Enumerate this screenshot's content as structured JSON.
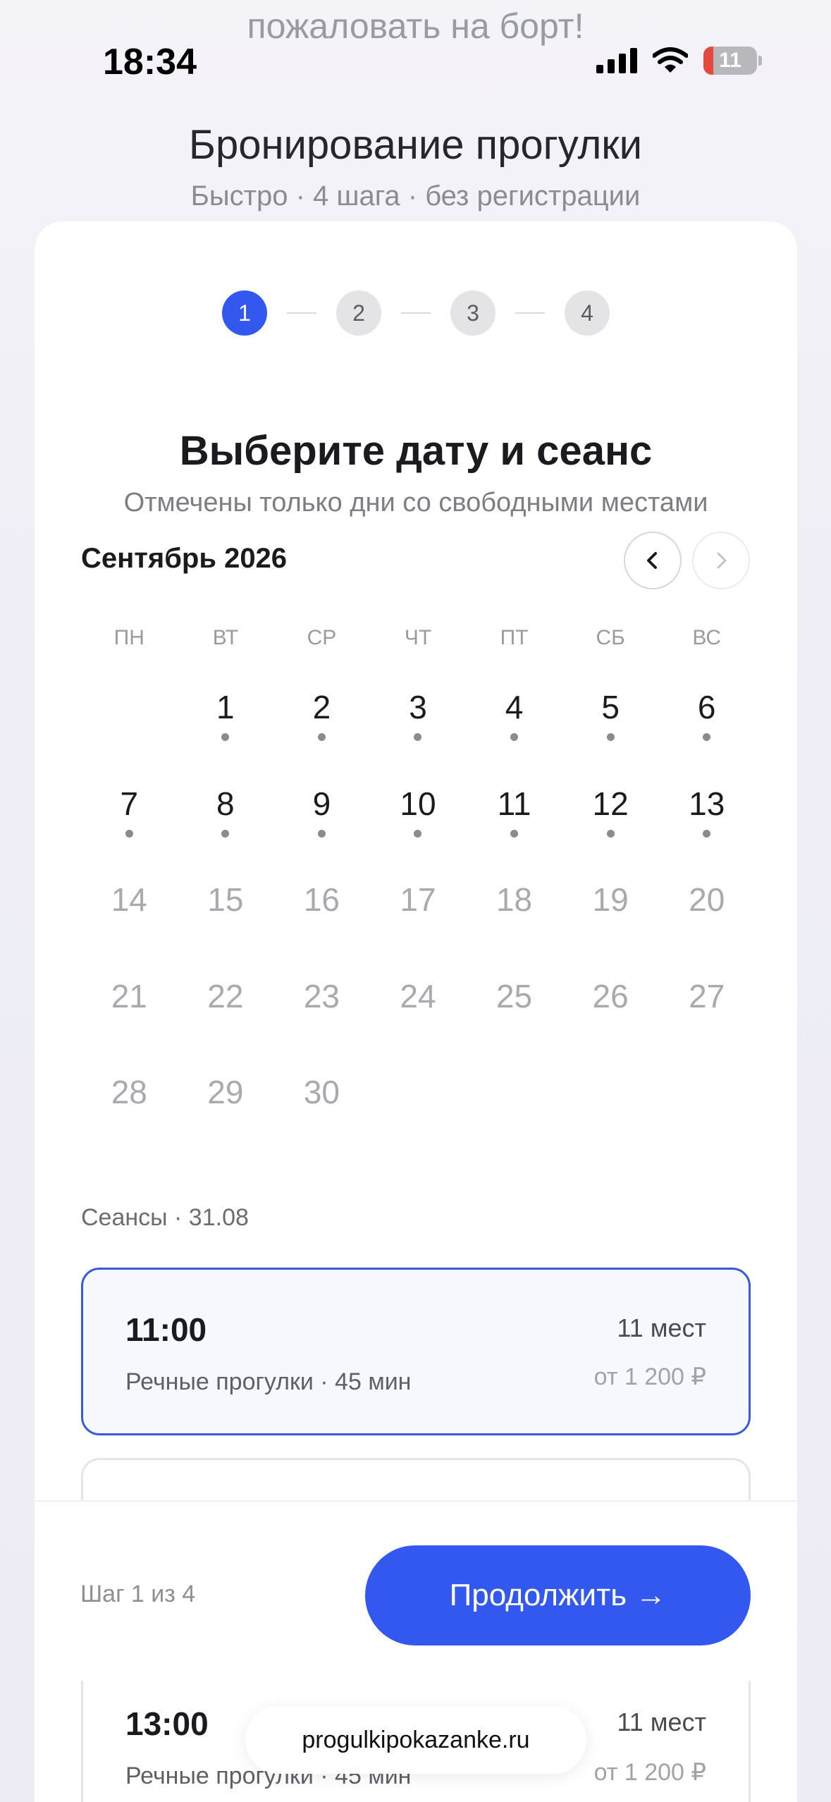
{
  "background_text": "пожаловать на борт!",
  "status_bar": {
    "time": "18:34",
    "battery": "11"
  },
  "header": {
    "title": "Бронирование прогулки",
    "subtitle": "Быстро · 4 шага · без регистрации"
  },
  "stepper": {
    "steps": [
      "1",
      "2",
      "3",
      "4"
    ],
    "active_step": 1
  },
  "calendar": {
    "title": "Выберите дату и сеанс",
    "hint": "Отмечены только дни со свободными местами",
    "month": "Сентябрь 2026",
    "prev_icon": "chevron-left-icon",
    "next_icon": "chevron-right-icon",
    "weekdays": [
      "ПН",
      "ВТ",
      "СР",
      "ЧТ",
      "ПТ",
      "СБ",
      "ВС"
    ],
    "leading_blanks": 1,
    "days": [
      {
        "label": "1",
        "available": true
      },
      {
        "label": "2",
        "available": true
      },
      {
        "label": "3",
        "available": true
      },
      {
        "label": "4",
        "available": true
      },
      {
        "label": "5",
        "available": true
      },
      {
        "label": "6",
        "available": true
      },
      {
        "label": "7",
        "available": true
      },
      {
        "label": "8",
        "available": true
      },
      {
        "label": "9",
        "available": true
      },
      {
        "label": "10",
        "available": true
      },
      {
        "label": "11",
        "available": true
      },
      {
        "label": "12",
        "available": true
      },
      {
        "label": "13",
        "available": true
      },
      {
        "label": "14",
        "available": false
      },
      {
        "label": "15",
        "available": false
      },
      {
        "label": "16",
        "available": false
      },
      {
        "label": "17",
        "available": false
      },
      {
        "label": "18",
        "available": false
      },
      {
        "label": "19",
        "available": false
      },
      {
        "label": "20",
        "available": false
      },
      {
        "label": "21",
        "available": false
      },
      {
        "label": "22",
        "available": false
      },
      {
        "label": "23",
        "available": false
      },
      {
        "label": "24",
        "available": false
      },
      {
        "label": "25",
        "available": false
      },
      {
        "label": "26",
        "available": false
      },
      {
        "label": "27",
        "available": false
      },
      {
        "label": "28",
        "available": false
      },
      {
        "label": "29",
        "available": false
      },
      {
        "label": "30",
        "available": false
      }
    ]
  },
  "sessions": {
    "label": "Сеансы · 31.08",
    "items": [
      {
        "time": "11:00",
        "description": "Речные прогулки · 45 мин",
        "seats": "11 мест",
        "price": "от 1 200 ₽",
        "selected": true
      },
      {
        "time": "13:00",
        "description": "Речные прогулки · 45 мин",
        "seats": "11 мест",
        "price": "от 1 200 ₽",
        "selected": false
      }
    ]
  },
  "footer": {
    "step_counter": "Шаг 1 из 4",
    "continue_label": "Продолжить →"
  },
  "browser": {
    "url": "progulkipokazanke.ru"
  },
  "colors": {
    "accent": "#3258f0",
    "selected_border": "#3a5ad8",
    "muted_text": "#a9a9af"
  }
}
